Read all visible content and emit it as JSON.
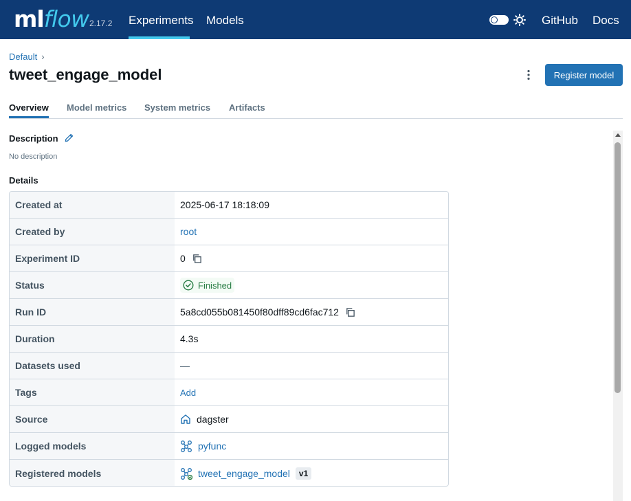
{
  "header": {
    "logo_ml": "ml",
    "logo_flow": "flow",
    "version": "2.17.2",
    "nav": [
      {
        "label": "Experiments"
      },
      {
        "label": "Models"
      },
      {
        "label": "GitHub"
      },
      {
        "label": "Docs"
      }
    ],
    "active_nav": "Experiments",
    "theme_toggle": "dark-mode-toggle",
    "theme_icon": "sun-icon"
  },
  "breadcrumb": {
    "item": "Default",
    "separator": "›"
  },
  "page": {
    "title": "tweet_engage_model",
    "register_button": "Register model",
    "more_icon": "kebab-menu-icon"
  },
  "tabs": [
    {
      "label": "Overview",
      "active": true
    },
    {
      "label": "Model metrics",
      "active": false
    },
    {
      "label": "System metrics",
      "active": false
    },
    {
      "label": "Artifacts",
      "active": false
    }
  ],
  "description": {
    "label": "Description",
    "empty_text": "No description"
  },
  "details": {
    "label": "Details",
    "rows": [
      {
        "key": "Created at",
        "value": "2025-06-17 18:18:09"
      },
      {
        "key": "Created by",
        "value": "root"
      },
      {
        "key": "Experiment ID",
        "value": "0"
      },
      {
        "key": "Status",
        "value": "Finished"
      },
      {
        "key": "Run ID",
        "value": "5a8cd055b081450f80dff89cd6fac712"
      },
      {
        "key": "Duration",
        "value": "4.3s"
      },
      {
        "key": "Datasets used",
        "value": "—"
      },
      {
        "key": "Tags",
        "value": "Add"
      },
      {
        "key": "Source",
        "value": "dagster"
      },
      {
        "key": "Logged models",
        "value": "pyfunc"
      },
      {
        "key": "Registered models",
        "value": "tweet_engage_model",
        "version": "v1"
      }
    ]
  },
  "colors": {
    "header_bg": "#0e3a74",
    "accent": "#43c9ed",
    "primary": "#2272b4",
    "success": "#277c43"
  }
}
